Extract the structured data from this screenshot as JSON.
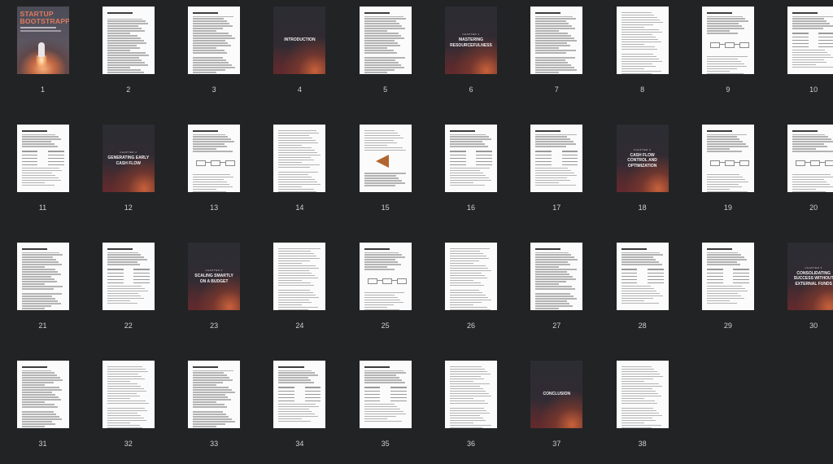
{
  "document": {
    "cover": {
      "title_line1": "STARTUP",
      "title_line2": "BOOTSTRAPPING"
    },
    "pages": [
      {
        "number": "1",
        "kind": "cover"
      },
      {
        "number": "2",
        "kind": "toc"
      },
      {
        "number": "3",
        "kind": "text"
      },
      {
        "number": "4",
        "kind": "chapter",
        "label": "",
        "title": "INTRODUCTION"
      },
      {
        "number": "5",
        "kind": "text"
      },
      {
        "number": "6",
        "kind": "chapter",
        "label": "CHAPTER 1",
        "title": "MASTERING RESOURCEFULNESS"
      },
      {
        "number": "7",
        "kind": "text"
      },
      {
        "number": "8",
        "kind": "text"
      },
      {
        "number": "9",
        "kind": "diagram"
      },
      {
        "number": "10",
        "kind": "table"
      },
      {
        "number": "11",
        "kind": "table"
      },
      {
        "number": "12",
        "kind": "chapter",
        "label": "CHAPTER 2",
        "title": "GENERATING EARLY CASH FLOW"
      },
      {
        "number": "13",
        "kind": "diagram"
      },
      {
        "number": "14",
        "kind": "text"
      },
      {
        "number": "15",
        "kind": "funnel"
      },
      {
        "number": "16",
        "kind": "table"
      },
      {
        "number": "17",
        "kind": "table"
      },
      {
        "number": "18",
        "kind": "chapter",
        "label": "CHAPTER 3",
        "title": "CASH FLOW CONTROL AND OPTIMIZATION"
      },
      {
        "number": "19",
        "kind": "diagram"
      },
      {
        "number": "20",
        "kind": "diagram"
      },
      {
        "number": "21",
        "kind": "text"
      },
      {
        "number": "22",
        "kind": "table"
      },
      {
        "number": "23",
        "kind": "chapter",
        "label": "CHAPTER 4",
        "title": "SCALING SMARTLY ON A BUDGET"
      },
      {
        "number": "24",
        "kind": "text"
      },
      {
        "number": "25",
        "kind": "diagram"
      },
      {
        "number": "26",
        "kind": "text"
      },
      {
        "number": "27",
        "kind": "text"
      },
      {
        "number": "28",
        "kind": "table"
      },
      {
        "number": "29",
        "kind": "table"
      },
      {
        "number": "30",
        "kind": "chapter",
        "label": "CHAPTER 5",
        "title": "CONSOLIDATING SUCCESS WITHOUT EXTERNAL FUNDS"
      },
      {
        "number": "31",
        "kind": "text"
      },
      {
        "number": "32",
        "kind": "text"
      },
      {
        "number": "33",
        "kind": "text"
      },
      {
        "number": "34",
        "kind": "table"
      },
      {
        "number": "35",
        "kind": "table"
      },
      {
        "number": "36",
        "kind": "text"
      },
      {
        "number": "37",
        "kind": "chapter",
        "label": "",
        "title": "CONCLUSION"
      },
      {
        "number": "38",
        "kind": "text"
      }
    ]
  },
  "colors": {
    "background": "#222324",
    "page_white": "#fbfbfb",
    "cover_title": "#e07a5f"
  }
}
